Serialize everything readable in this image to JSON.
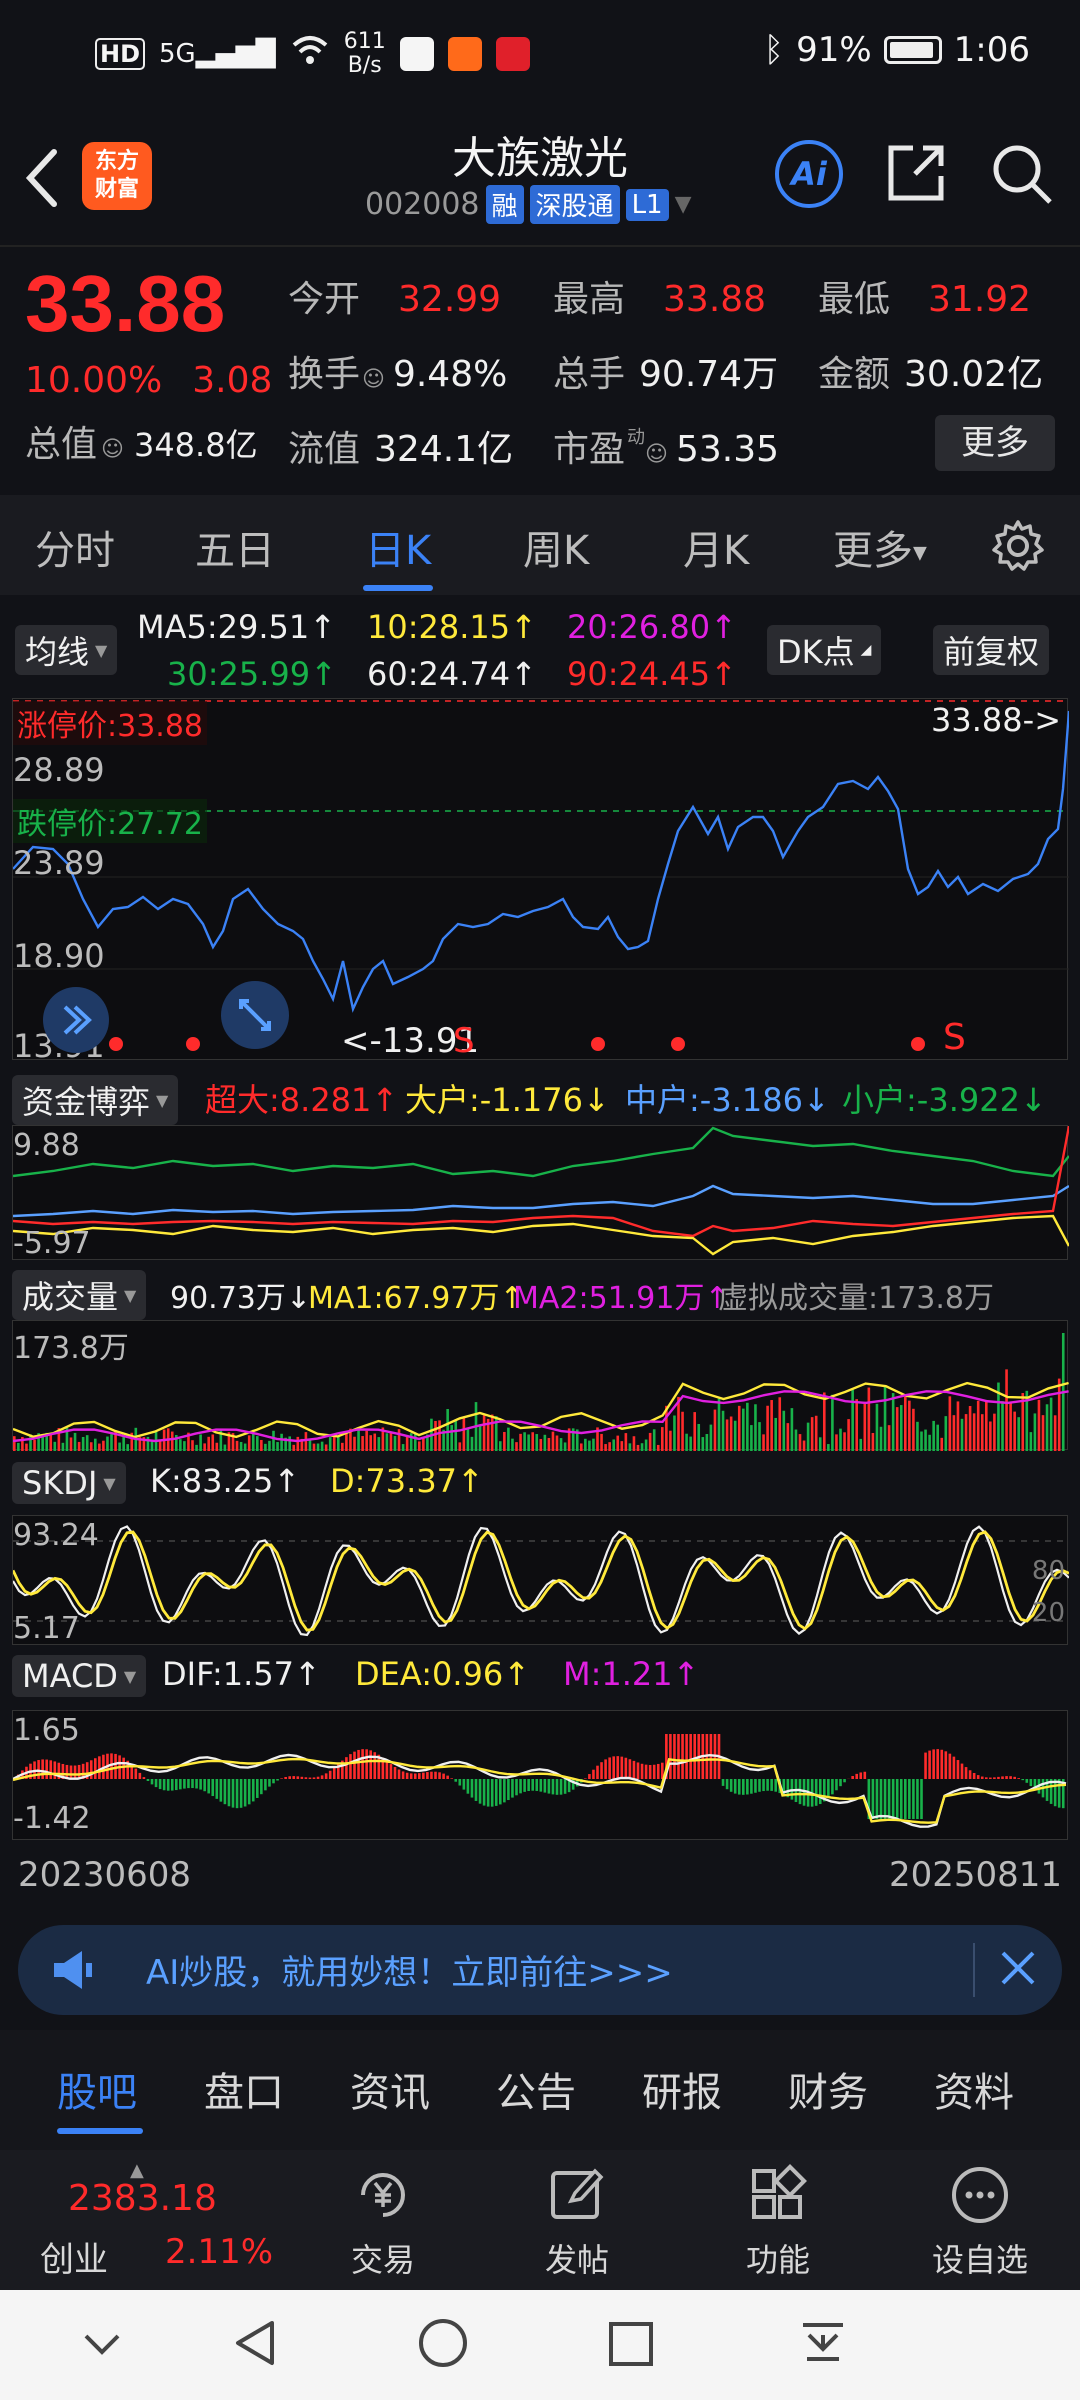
{
  "status": {
    "net_speed": "611",
    "net_unit": "B/s",
    "battery": "91%",
    "time": "1:06",
    "hd": "HD",
    "sig": "5G"
  },
  "header": {
    "title": "大族激光",
    "code": "002008",
    "tag_rong": "融",
    "tag_sgt": "深股通",
    "tag_l1": "L1",
    "logo_text1": "东方",
    "logo_text2": "财富",
    "ai_label": "Ai"
  },
  "quote": {
    "price": "33.88",
    "pct": "10.00%",
    "chg": "3.08",
    "open_label": "今开",
    "open": "32.99",
    "high_label": "最高",
    "high": "33.88",
    "low_label": "最低",
    "low": "31.92",
    "turnover_label": "换手",
    "turnover": "9.48%",
    "vol_label": "总手",
    "vol": "90.74万",
    "amount_label": "金额",
    "amount": "30.02亿",
    "mcap_label": "总值",
    "mcap": "348.8亿",
    "float_label": "流值",
    "float": "324.1亿",
    "pe_label": "市盈",
    "pe_sup": "动",
    "pe": "53.35",
    "more": "更多"
  },
  "tabs": [
    "分时",
    "五日",
    "日K",
    "周K",
    "月K",
    "更多"
  ],
  "kline": {
    "ma_btn": "均线",
    "ma5": "MA5:29.51↑",
    "ma10": "10:28.15↑",
    "ma20": "20:26.80↑",
    "ma30": "30:25.99↑",
    "ma60": "60:24.74↑",
    "ma90": "90:24.45↑",
    "dk_btn": "DK点",
    "fq_btn": "前复权",
    "y_labels": [
      "33.88",
      "28.89",
      "23.89",
      "18.90",
      "13.91"
    ],
    "limit_up": "涨停价:33.88",
    "limit_down": "跌停价:27.72",
    "last_price": "33.88->",
    "min_label": "<-13.91",
    "s_marks": [
      "S",
      "S"
    ]
  },
  "capital": {
    "btn": "资金博弈",
    "super": "超大:8.281↑",
    "big": "大户:-1.176↓",
    "mid": "中户:-3.186↓",
    "small": "小户:-3.922↓",
    "y_top": "9.88",
    "y_bottom": "-5.97"
  },
  "volume": {
    "btn": "成交量",
    "value": "90.73万↓",
    "ma1": "MA1:67.97万↑",
    "ma2": "MA2:51.91万↑",
    "virtual": "虚拟成交量:173.8万",
    "y_top": "173.8万"
  },
  "skdj": {
    "btn": "SKDJ",
    "k": "K:83.25↑",
    "d": "D:73.37↑",
    "y_top": "93.24",
    "y_bottom": "5.17",
    "r80": "80",
    "r20": "20"
  },
  "macd": {
    "btn": "MACD",
    "dif": "DIF:1.57↑",
    "dea": "DEA:0.96↑",
    "m": "M:1.21↑",
    "y_top": "1.65",
    "y_bottom": "-1.42"
  },
  "dates": {
    "start": "20230608",
    "end": "20250811"
  },
  "banner": {
    "text": "AI炒股，就用妙想！立即前往>>>"
  },
  "bottom_tabs": [
    "股吧",
    "盘口",
    "资讯",
    "公告",
    "研报",
    "财务",
    "资料"
  ],
  "footer": {
    "index_value": "2383.18",
    "index_name": "创业",
    "index_pct": "2.11%",
    "items": [
      "交易",
      "发帖",
      "功能",
      "设自选"
    ]
  },
  "colors": {
    "accent": "#3b82f6",
    "up": "#ff2b2b",
    "down": "#18b24a",
    "yellow": "#ffe93b",
    "magenta": "#e020e0"
  }
}
